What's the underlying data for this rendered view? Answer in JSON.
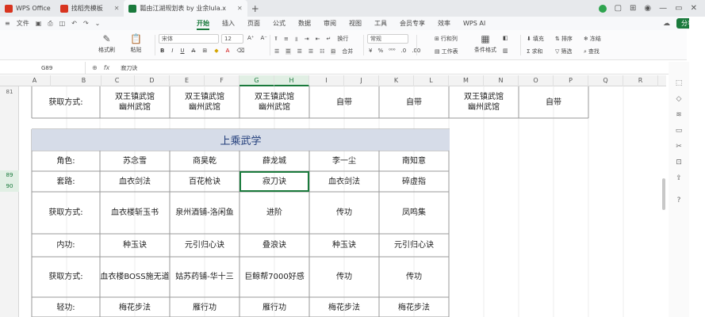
{
  "titlebar": {
    "tabs": [
      {
        "label": "WPS Office",
        "color": "#d8341f"
      },
      {
        "label": "找稻壳模板",
        "color": "#d8341f"
      },
      {
        "label": "瓢由江湖规划表 by 业余lula.x",
        "color": "#1a7a3c"
      }
    ],
    "plus": "+"
  },
  "menubar": {
    "file": "文件",
    "items": [
      "开始",
      "插入",
      "页面",
      "公式",
      "数据",
      "审阅",
      "视图",
      "工具",
      "会员专享",
      "效率"
    ],
    "active": "开始",
    "wps_ai": "WPS AI",
    "share": "分享"
  },
  "ribbon": {
    "format_painter": "格式刷",
    "paste": "粘贴",
    "font_name": "宋体",
    "font_size": "12",
    "merge": "合并",
    "wrap": "换行",
    "number_format": "常规",
    "row_col": "行和列",
    "worksheet": "工作表",
    "cond_format": "条件格式",
    "fill": "填充",
    "sort": "排序",
    "freeze": "冻结",
    "sum": "求和",
    "filter": "筛选",
    "find": "查找"
  },
  "formula": {
    "cell_ref": "G89",
    "fx": "fx",
    "value": "寂刀诀"
  },
  "columns": [
    "A",
    "B",
    "C",
    "D",
    "E",
    "F",
    "G",
    "H",
    "I",
    "J",
    "K",
    "L",
    "M",
    "N",
    "O",
    "P",
    "Q",
    "R"
  ],
  "rows": [
    "81",
    "",
    "",
    "",
    "",
    "89",
    "90",
    "",
    "",
    "",
    "",
    "",
    ""
  ],
  "row_labels": {
    "r81": "81",
    "r89": "89",
    "r90": "90"
  },
  "sheet": {
    "top": {
      "label": "获取方式:",
      "c1": "双王镇武馆\n幽州武馆",
      "c2": "双王镇武馆\n幽州武馆",
      "c3": "双王镇武馆\n幽州武馆",
      "c4": "自带",
      "c5": "自带",
      "c6": "双王镇武馆\n幽州武馆",
      "c7": "自带"
    },
    "section_title": "上乘武学",
    "rows": [
      {
        "label": "角色:",
        "cells": [
          "苏念雪",
          "商昊乾",
          "薛龙城",
          "李一尘",
          "南知意"
        ]
      },
      {
        "label": "套路:",
        "cells": [
          "血衣剑法",
          "百花枪诀",
          "寂刀诀",
          "血衣剑法",
          "碎虚指"
        ]
      },
      {
        "label": "获取方式:",
        "cells": [
          "血衣楼斩玉书",
          "泉州酒铺-洛闲鱼",
          "进阶",
          "传功",
          "凤鸣集"
        ]
      },
      {
        "label": "内功:",
        "cells": [
          "种玉诀",
          "元引归心诀",
          "叠浪诀",
          "种玉诀",
          "元引归心诀"
        ]
      },
      {
        "label": "获取方式:",
        "cells": [
          "血衣楼BOSS施无道",
          "姑苏药铺-华十三",
          "巨鲸帮7000好感",
          "传功",
          "传功"
        ]
      },
      {
        "label": "轻功:",
        "cells": [
          "梅花步法",
          "雁行功",
          "雁行功",
          "梅花步法",
          "梅花步法"
        ]
      }
    ]
  }
}
